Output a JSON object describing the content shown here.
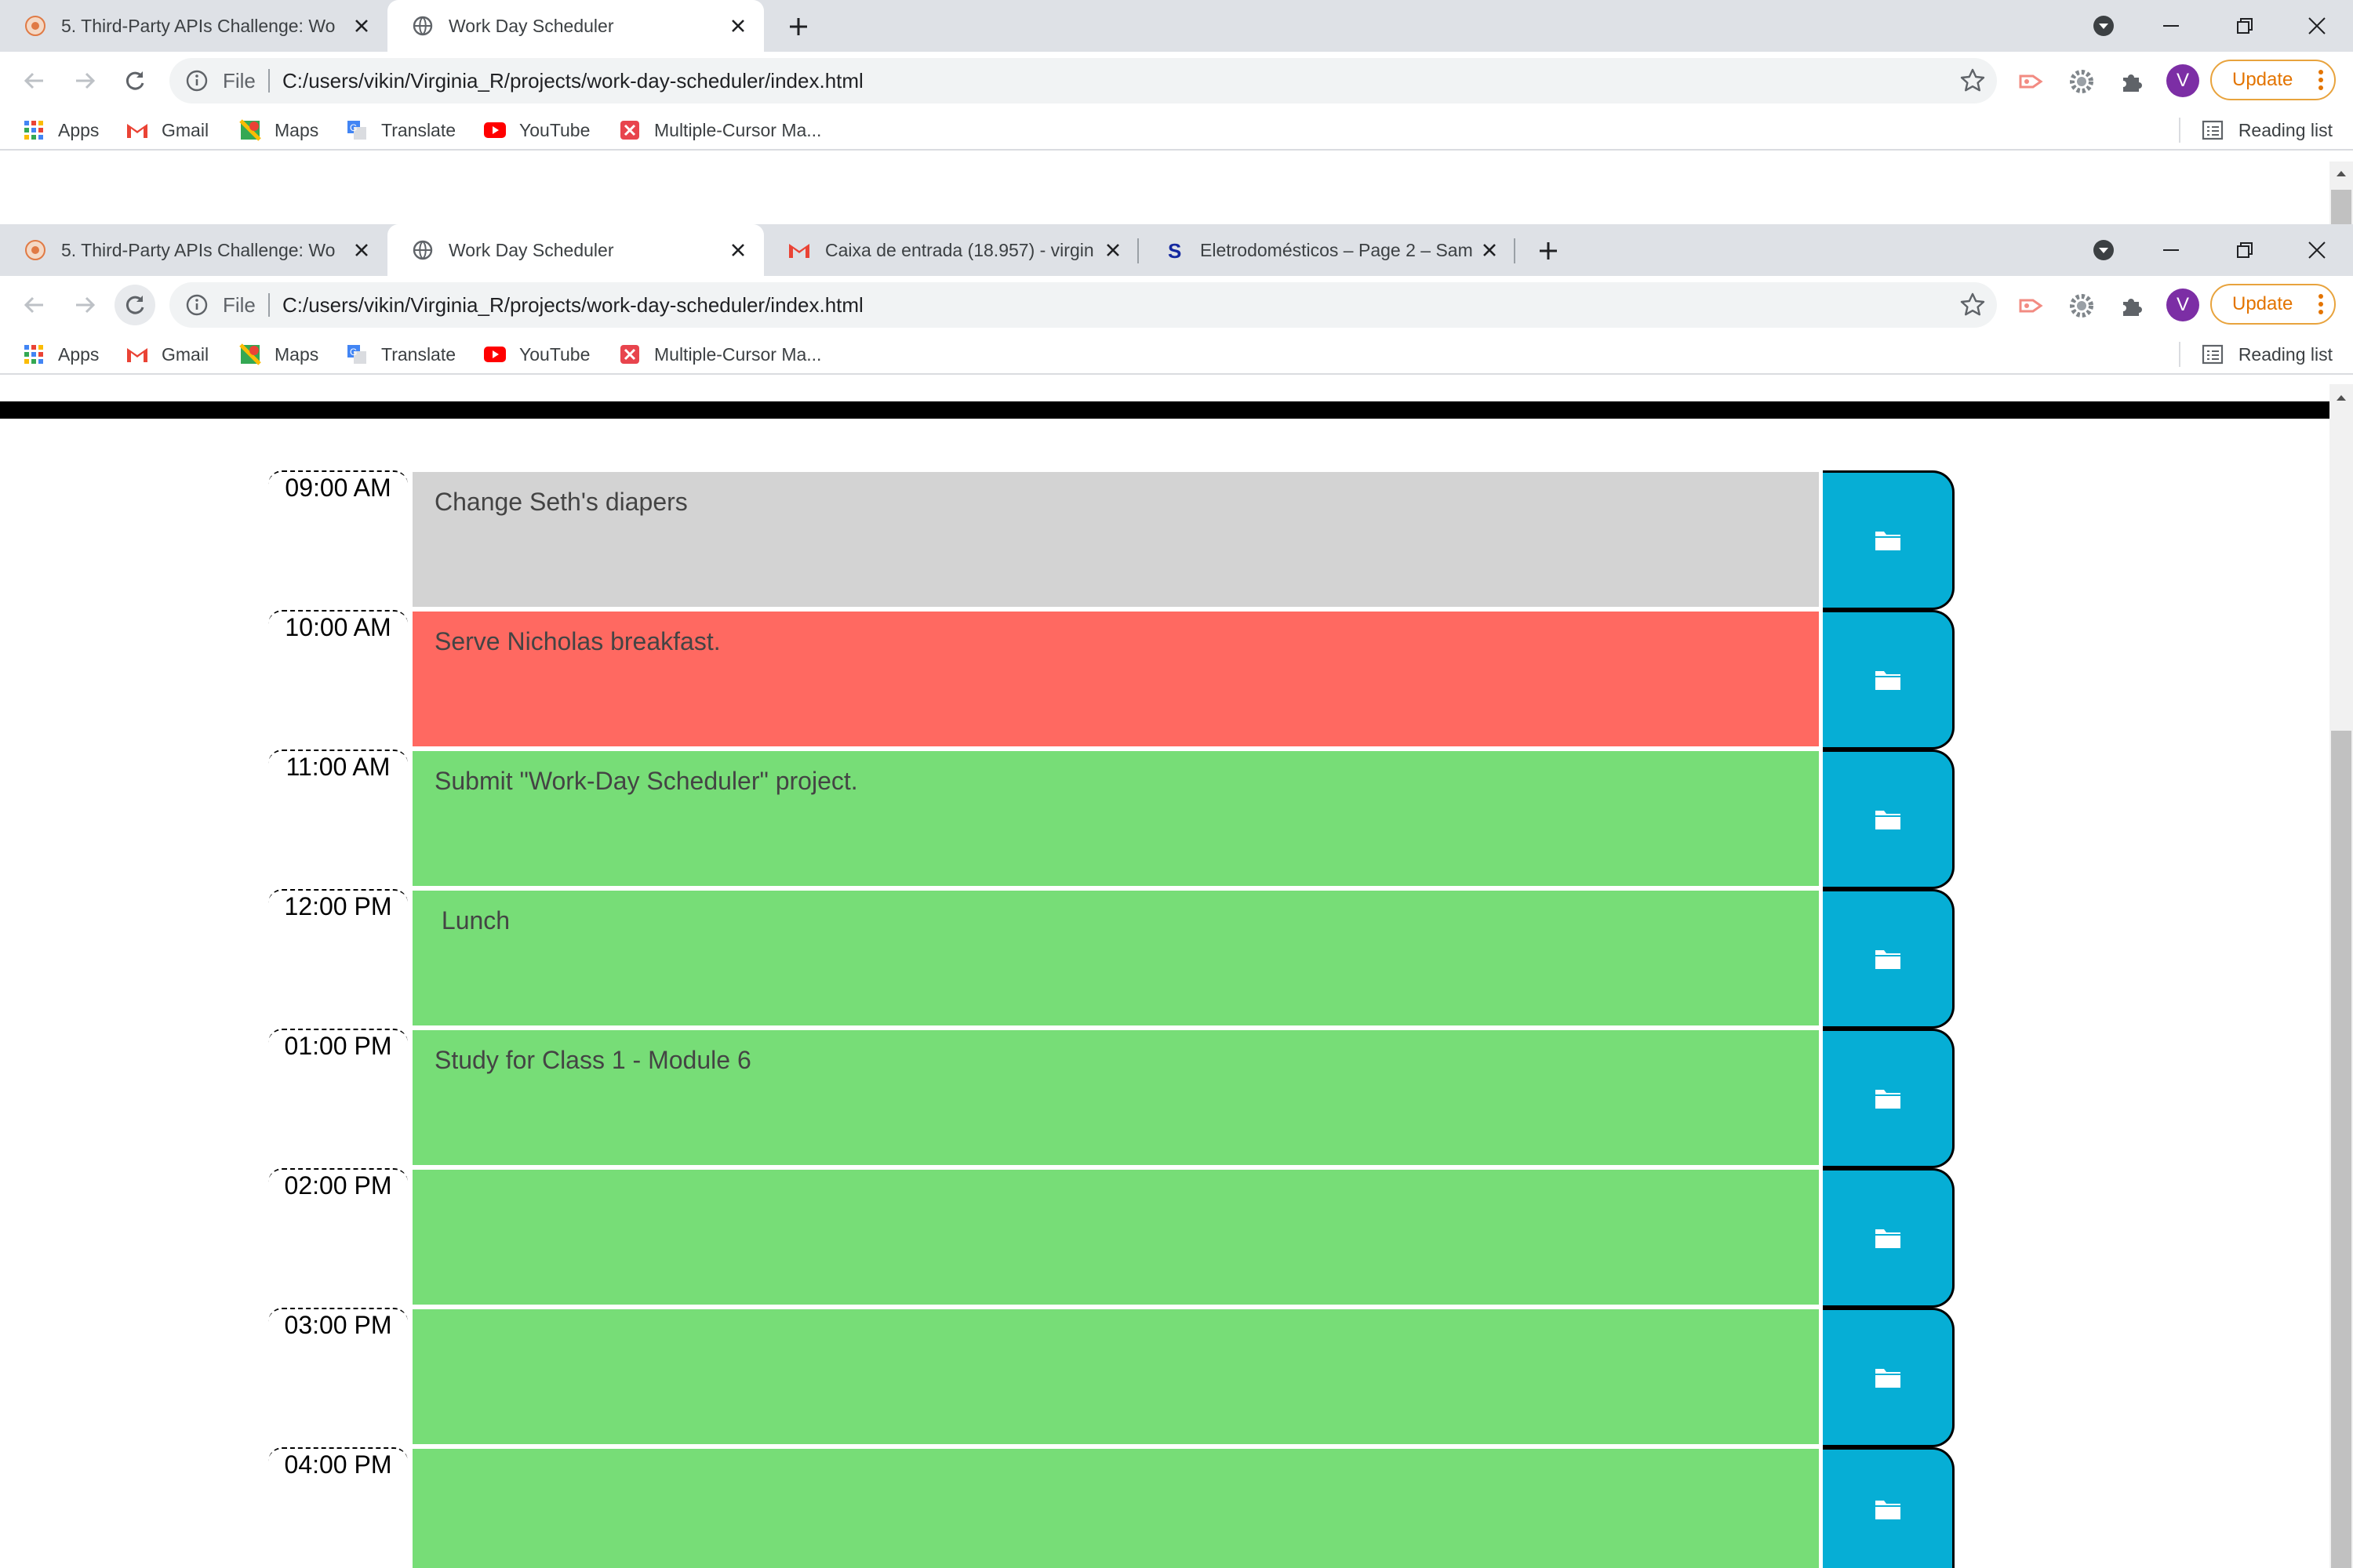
{
  "browser_back": {
    "tabs": [
      {
        "title": "5. Third-Party APIs Challenge: Wo",
        "active": false
      },
      {
        "title": "Work Day Scheduler",
        "active": true
      }
    ],
    "omnibox": {
      "scheme_label": "File",
      "url": "C:/users/vikin/Virginia_R/projects/work-day-scheduler/index.html"
    },
    "profile_initial": "V",
    "update_label": "Update"
  },
  "browser_front": {
    "tabs": [
      {
        "title": "5. Third-Party APIs Challenge: Wo",
        "active": false
      },
      {
        "title": "Work Day Scheduler",
        "active": true
      },
      {
        "title": "Caixa de entrada (18.957) - virgin",
        "active": false
      },
      {
        "title": "Eletrodomésticos – Page 2 – Sam",
        "active": false
      }
    ],
    "omnibox": {
      "scheme_label": "File",
      "url": "C:/users/vikin/Virginia_R/projects/work-day-scheduler/index.html"
    },
    "profile_initial": "V",
    "update_label": "Update"
  },
  "bookmarks": {
    "items": [
      "Apps",
      "Gmail",
      "Maps",
      "Translate",
      "YouTube",
      "Multiple-Cursor Ma..."
    ],
    "reading_list": "Reading list"
  },
  "scheduler": {
    "rows": [
      {
        "hour": "09:00 AM",
        "text": "Change Seth's diapers",
        "state": "past"
      },
      {
        "hour": "10:00 AM",
        "text": "Serve Nicholas breakfast.",
        "state": "present"
      },
      {
        "hour": "11:00 AM",
        "text": "Submit \"Work-Day Scheduler\" project.",
        "state": "future"
      },
      {
        "hour": "12:00 PM",
        "text": " Lunch",
        "state": "future"
      },
      {
        "hour": "01:00 PM",
        "text": "Study for Class 1 - Module 6",
        "state": "future"
      },
      {
        "hour": "02:00 PM",
        "text": "",
        "state": "future"
      },
      {
        "hour": "03:00 PM",
        "text": "",
        "state": "future"
      },
      {
        "hour": "04:00 PM",
        "text": "",
        "state": "future"
      }
    ]
  },
  "colors": {
    "past": "#d3d3d3",
    "present": "#ff6961",
    "future": "#77dd77",
    "save_button": "#06aed5",
    "update_accent": "#e37400",
    "avatar": "#7c2ea5"
  },
  "icons": {
    "save": "folder-icon",
    "back": "arrow-left-icon",
    "forward": "arrow-right-icon",
    "reload": "reload-icon",
    "bookmark_star": "star-icon",
    "extensions": "puzzle-icon"
  }
}
